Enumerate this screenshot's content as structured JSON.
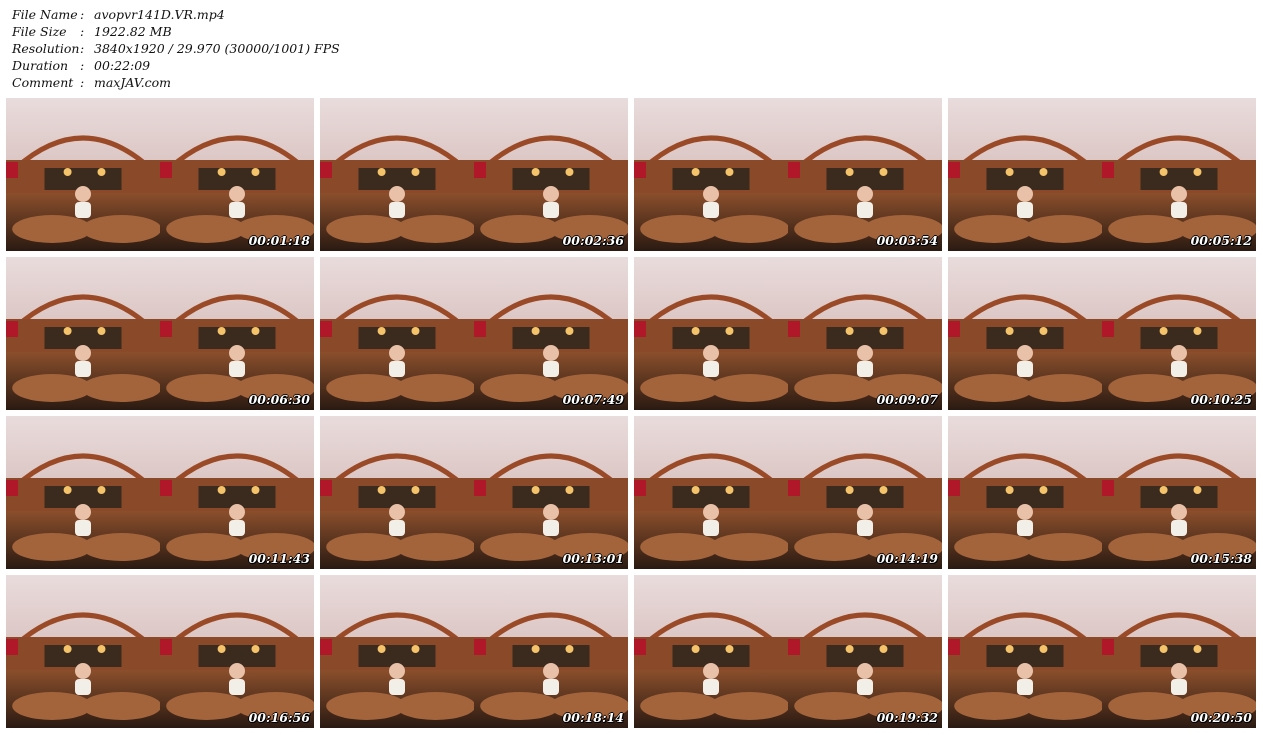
{
  "info": {
    "rows": [
      {
        "key": "File Name",
        "sep": ":",
        "value": "avopvr141D.VR.mp4"
      },
      {
        "key": "File Size",
        "sep": ":",
        "value": "1922.82 MB"
      },
      {
        "key": "Resolution",
        "sep": ":",
        "value": "3840x1920 / 29.970 (30000/1001) FPS"
      },
      {
        "key": "Duration",
        "sep": ":",
        "value": "00:22:09"
      },
      {
        "key": "Comment",
        "sep": ":",
        "value": "maxJAV.com"
      }
    ]
  },
  "thumbnails": [
    {
      "time": "00:01:18"
    },
    {
      "time": "00:02:36"
    },
    {
      "time": "00:03:54"
    },
    {
      "time": "00:05:12"
    },
    {
      "time": "00:06:30"
    },
    {
      "time": "00:07:49"
    },
    {
      "time": "00:09:07"
    },
    {
      "time": "00:10:25"
    },
    {
      "time": "00:11:43"
    },
    {
      "time": "00:13:01"
    },
    {
      "time": "00:14:19"
    },
    {
      "time": "00:15:38"
    },
    {
      "time": "00:16:56"
    },
    {
      "time": "00:18:14"
    },
    {
      "time": "00:19:32"
    },
    {
      "time": "00:20:50"
    }
  ],
  "colors": {
    "ceiling": "#e9dcdc",
    "wall": "#8a4a2a",
    "floor": "#6b3d22",
    "accent_red": "#b0182a",
    "light": "#f4c36a"
  }
}
